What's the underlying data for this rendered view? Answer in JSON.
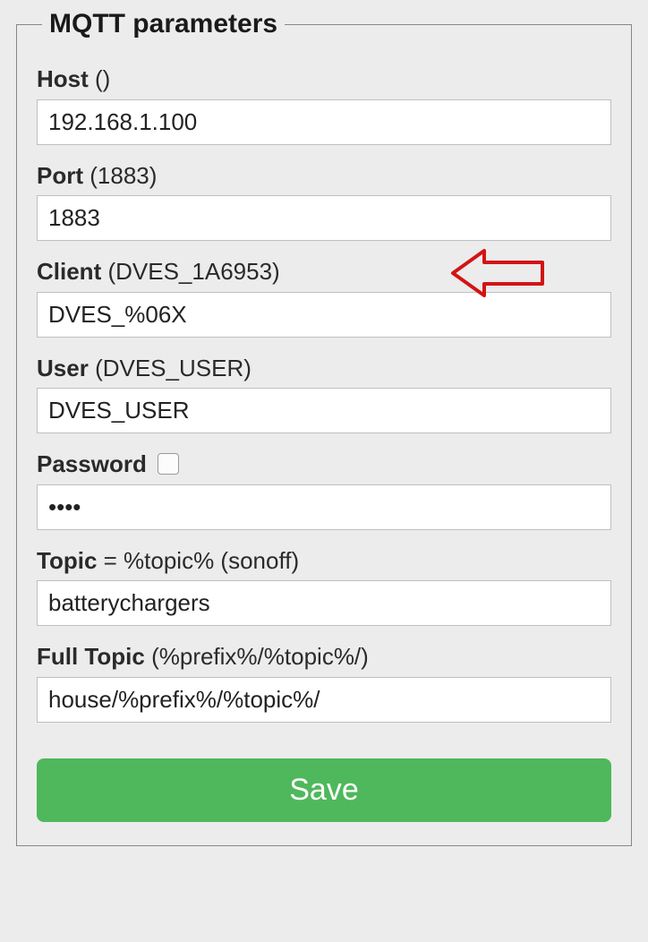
{
  "panel": {
    "title": "MQTT parameters"
  },
  "fields": {
    "host": {
      "label": "Host",
      "hint": "()",
      "value": "192.168.1.100"
    },
    "port": {
      "label": "Port",
      "hint": "(1883)",
      "value": "1883"
    },
    "client": {
      "label": "Client",
      "hint": "(DVES_1A6953)",
      "value": "DVES_%06X"
    },
    "user": {
      "label": "User",
      "hint": "(DVES_USER)",
      "value": "DVES_USER"
    },
    "password": {
      "label": "Password",
      "value": "••••"
    },
    "topic": {
      "label": "Topic",
      "hint": "= %topic% (sonoff)",
      "value": "batterychargers"
    },
    "fulltopic": {
      "label": "Full Topic",
      "hint": "(%prefix%/%topic%/)",
      "value": "house/%prefix%/%topic%/"
    }
  },
  "buttons": {
    "save": "Save"
  }
}
